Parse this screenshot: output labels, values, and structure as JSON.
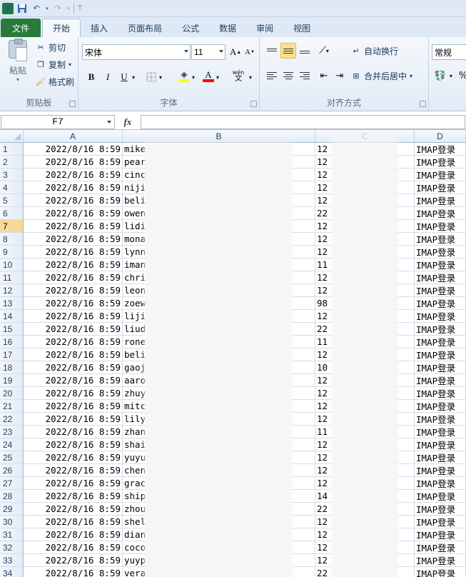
{
  "qat": {
    "undo_icon": "undo-arrow",
    "redo_icon": "redo-arrow"
  },
  "tabs": [
    "文件",
    "开始",
    "插入",
    "页面布局",
    "公式",
    "数据",
    "审阅",
    "视图"
  ],
  "clipboard": {
    "paste": "粘贴",
    "cut": "剪切",
    "copy": "复制",
    "format_painter": "格式刷",
    "group": "剪贴板"
  },
  "font": {
    "name": "宋体",
    "size": "11",
    "group": "字体",
    "bold": "B",
    "italic": "I",
    "underline": "U",
    "grow": "A",
    "shrink": "A",
    "wen": "wén"
  },
  "alignment": {
    "wrap": "自动换行",
    "merge": "合并后居中",
    "group": "对齐方式"
  },
  "number": {
    "format": "常规",
    "percent": "%"
  },
  "formula_bar": {
    "namebox": "F7",
    "fx": "fx",
    "value": ""
  },
  "columns": [
    "A",
    "B",
    "C",
    "D"
  ],
  "selected_row": 7,
  "rows": [
    {
      "n": "1",
      "a": "2022/8/16 8:59",
      "b": "mike",
      "c": "12",
      "d": "IMAP登录"
    },
    {
      "n": "2",
      "a": "2022/8/16 8:59",
      "b": "pear",
      "c": "12",
      "d": "IMAP登录"
    },
    {
      "n": "3",
      "a": "2022/8/16 8:59",
      "b": "cinc",
      "c": "12",
      "d": "IMAP登录"
    },
    {
      "n": "4",
      "a": "2022/8/16 8:59",
      "b": "niji",
      "c": "12",
      "d": "IMAP登录"
    },
    {
      "n": "5",
      "a": "2022/8/16 8:59",
      "b": "beli",
      "c": "12",
      "d": "IMAP登录"
    },
    {
      "n": "6",
      "a": "2022/8/16 8:59",
      "b": "owen",
      "c": "22",
      "d": "IMAP登录"
    },
    {
      "n": "7",
      "a": "2022/8/16 8:59",
      "b": "lidi",
      "c": "12",
      "d": "IMAP登录"
    },
    {
      "n": "8",
      "a": "2022/8/16 8:59",
      "b": "mona",
      "c": "12",
      "d": "IMAP登录"
    },
    {
      "n": "9",
      "a": "2022/8/16 8:59",
      "b": "lynn",
      "c": "12",
      "d": "IMAP登录"
    },
    {
      "n": "10",
      "a": "2022/8/16 8:59",
      "b": "iman",
      "c": "11",
      "d": "IMAP登录"
    },
    {
      "n": "11",
      "a": "2022/8/16 8:59",
      "b": "chri",
      "c": "12",
      "d": "IMAP登录"
    },
    {
      "n": "12",
      "a": "2022/8/16 8:59",
      "b": "leon",
      "c": "12",
      "d": "IMAP登录"
    },
    {
      "n": "13",
      "a": "2022/8/16 8:59",
      "b": "zoew",
      "c": "98",
      "d": "IMAP登录"
    },
    {
      "n": "14",
      "a": "2022/8/16 8:59",
      "b": "liji",
      "c": "12",
      "d": "IMAP登录"
    },
    {
      "n": "15",
      "a": "2022/8/16 8:59",
      "b": "liud",
      "c": "22",
      "d": "IMAP登录"
    },
    {
      "n": "16",
      "a": "2022/8/16 8:59",
      "b": "rone",
      "c": "11",
      "d": "IMAP登录"
    },
    {
      "n": "17",
      "a": "2022/8/16 8:59",
      "b": "beli",
      "c": "12",
      "d": "IMAP登录"
    },
    {
      "n": "18",
      "a": "2022/8/16 8:59",
      "b": "gaoj",
      "c": "10",
      "d": "IMAP登录"
    },
    {
      "n": "19",
      "a": "2022/8/16 8:59",
      "b": "aaro",
      "c": "12",
      "d": "IMAP登录"
    },
    {
      "n": "20",
      "a": "2022/8/16 8:59",
      "b": "zhuy",
      "c": "12",
      "d": "IMAP登录"
    },
    {
      "n": "21",
      "a": "2022/8/16 8:59",
      "b": "mitc",
      "c": "12",
      "d": "IMAP登录"
    },
    {
      "n": "22",
      "a": "2022/8/16 8:59",
      "b": "lily",
      "c": "12",
      "d": "IMAP登录"
    },
    {
      "n": "23",
      "a": "2022/8/16 8:59",
      "b": "zhan",
      "c": "11",
      "d": "IMAP登录"
    },
    {
      "n": "24",
      "a": "2022/8/16 8:59",
      "b": "shai",
      "c": "12",
      "d": "IMAP登录"
    },
    {
      "n": "25",
      "a": "2022/8/16 8:59",
      "b": "yuyu",
      "c": "12",
      "d": "IMAP登录"
    },
    {
      "n": "26",
      "a": "2022/8/16 8:59",
      "b": "chen",
      "c": "12",
      "d": "IMAP登录"
    },
    {
      "n": "27",
      "a": "2022/8/16 8:59",
      "b": "grac",
      "c": "12",
      "d": "IMAP登录"
    },
    {
      "n": "28",
      "a": "2022/8/16 8:59",
      "b": "ship",
      "c": "14",
      "d": "IMAP登录"
    },
    {
      "n": "29",
      "a": "2022/8/16 8:59",
      "b": "zhou",
      "c": "22",
      "d": "IMAP登录"
    },
    {
      "n": "30",
      "a": "2022/8/16 8:59",
      "b": "shel",
      "c": "12",
      "d": "IMAP登录"
    },
    {
      "n": "31",
      "a": "2022/8/16 8:59",
      "b": "dian",
      "c": "12",
      "d": "IMAP登录"
    },
    {
      "n": "32",
      "a": "2022/8/16 8:59",
      "b": "coco",
      "c": "12",
      "d": "IMAP登录"
    },
    {
      "n": "33",
      "a": "2022/8/16 8:59",
      "b": "yuyp",
      "c": "12",
      "d": "IMAP登录"
    },
    {
      "n": "34",
      "a": "2022/8/16 8:59",
      "b": "vera",
      "c": "22",
      "d": "IMAP登录"
    }
  ]
}
